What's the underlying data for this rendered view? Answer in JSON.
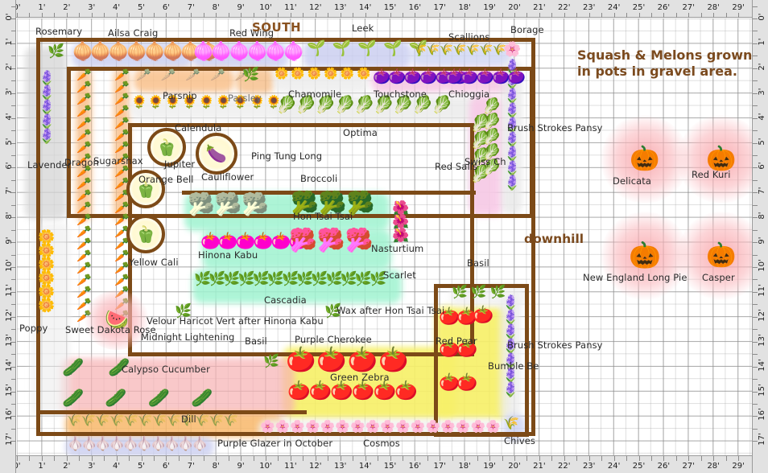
{
  "app": {
    "type": "garden-planner",
    "unit": "feet",
    "grid_cols": 30,
    "grid_rows": 18
  },
  "rulers": {
    "horizontal_ticks": [
      "0'",
      "1'",
      "2'",
      "3'",
      "4'",
      "5'",
      "6'",
      "7'",
      "8'",
      "9'",
      "10'",
      "11'",
      "12'",
      "13'",
      "14'",
      "15'",
      "16'",
      "17'",
      "18'",
      "19'",
      "20'",
      "21'",
      "22'",
      "23'",
      "24'",
      "25'",
      "26'",
      "27'",
      "28'",
      "29'"
    ],
    "vertical_ticks": [
      "0'",
      "1'",
      "2'",
      "3'",
      "4'",
      "5'",
      "6'",
      "7'",
      "8'",
      "9'",
      "10'",
      "11'",
      "12'",
      "13'",
      "14'",
      "15'",
      "16'",
      "17'"
    ]
  },
  "annotations": {
    "compass_south": "SOUTH",
    "gravel_note_line1": "Squash & Melons grown",
    "gravel_note_line2": "in pots in gravel area.",
    "downhill": "downhill"
  },
  "colors": {
    "bed_border": "#7c4a17",
    "note_text": "#7b4a1e",
    "compass_text": "#8a5220",
    "label_text": "#2b2b2b",
    "ruler_bg": "#e2e2e2",
    "grid_line": "#969696",
    "halo_pink": "#f8a0a5",
    "tomato_bed": "#f7f06a",
    "brassica_bed": "#9ff3d0",
    "chard_bed": "#f9c6e6",
    "carrot_bed": "#f9c08a",
    "onion_bed": "#c9cdf0",
    "lavender_bed": "#d9d9d9"
  },
  "labels": [
    {
      "id": "rosemary",
      "text": "Rosemary"
    },
    {
      "id": "ailsa-craig",
      "text": "Ailsa Craig"
    },
    {
      "id": "red-wing",
      "text": "Red Wing"
    },
    {
      "id": "leek",
      "text": "Leek"
    },
    {
      "id": "scallions",
      "text": "Scallions"
    },
    {
      "id": "borage",
      "text": "Borage"
    },
    {
      "id": "parsnip",
      "text": "Parsnip"
    },
    {
      "id": "parsley",
      "text": "Parsley"
    },
    {
      "id": "chamomile",
      "text": "Chamomile"
    },
    {
      "id": "touchstone",
      "text": "Touchstone"
    },
    {
      "id": "chioggia",
      "text": "Chioggia"
    },
    {
      "id": "lavender",
      "text": "Lavender"
    },
    {
      "id": "dragon",
      "text": "Dragon"
    },
    {
      "id": "sugarsnax",
      "text": "Sugarsnax"
    },
    {
      "id": "calendula",
      "text": "Calendula"
    },
    {
      "id": "optima",
      "text": "Optima"
    },
    {
      "id": "jupiter",
      "text": "Jupiter"
    },
    {
      "id": "ping-tung-long",
      "text": "Ping Tung Long"
    },
    {
      "id": "brush-strokes-pansy-top",
      "text": "Brush Strokes Pansy"
    },
    {
      "id": "orange-bell",
      "text": "Orange Bell"
    },
    {
      "id": "cauliflower",
      "text": "Cauliflower"
    },
    {
      "id": "broccoli",
      "text": "Broccoli"
    },
    {
      "id": "swiss-chard",
      "text": "Swiss Ch"
    },
    {
      "id": "red-sails",
      "text": "Red Sails"
    },
    {
      "id": "hon-tsai-tsai",
      "text": "Hon Tsai Tsai"
    },
    {
      "id": "yellow-cali",
      "text": "Yellow Cali"
    },
    {
      "id": "hinona-kabu",
      "text": "Hinona Kabu"
    },
    {
      "id": "nasturtium",
      "text": "Nasturtium"
    },
    {
      "id": "scarlet",
      "text": "Scarlet"
    },
    {
      "id": "basil-top-right",
      "text": "Basil"
    },
    {
      "id": "cascadia",
      "text": "Cascadia"
    },
    {
      "id": "wax-after-hon-tsai-tsai",
      "text": "Wax after Hon Tsai Tsai"
    },
    {
      "id": "velour-haricot-vert",
      "text": "Velour Haricot Vert after Hinona Kabu"
    },
    {
      "id": "poppy",
      "text": "Poppy"
    },
    {
      "id": "sweet-dakota-rose",
      "text": "Sweet Dakota Rose"
    },
    {
      "id": "midnight-lightening",
      "text": "Midnight Lightening"
    },
    {
      "id": "basil-mid",
      "text": "Basil"
    },
    {
      "id": "purple-cherokee",
      "text": "Purple Cherokee"
    },
    {
      "id": "red-pear",
      "text": "Red Pear"
    },
    {
      "id": "brush-strokes-pansy-bottom",
      "text": "Brush Strokes Pansy"
    },
    {
      "id": "bumble-bee",
      "text": "Bumble Be"
    },
    {
      "id": "green-zebra",
      "text": "Green Zebra"
    },
    {
      "id": "calypso-cucumber",
      "text": "Calypso Cucumber"
    },
    {
      "id": "dill",
      "text": "Dill"
    },
    {
      "id": "purple-glazer",
      "text": "Purple Glazer in October"
    },
    {
      "id": "cosmos",
      "text": "Cosmos"
    },
    {
      "id": "chives",
      "text": "Chives"
    },
    {
      "id": "delicata",
      "text": "Delicata"
    },
    {
      "id": "red-kuri",
      "text": "Red Kuri"
    },
    {
      "id": "new-england-long-pie",
      "text": "New England Long Pie"
    },
    {
      "id": "casper",
      "text": "Casper"
    }
  ],
  "plant_labels": {
    "rosemary": "Rosemary",
    "ailsa_craig": "Ailsa Craig",
    "red_wing": "Red Wing",
    "leek": "Leek",
    "scallions": "Scallions",
    "borage": "Borage",
    "parsnip": "Parsnip",
    "parsley": "Parsley",
    "chamomile": "Chamomile",
    "touchstone": "Touchstone",
    "chioggia": "Chioggia",
    "lavender": "Lavender",
    "dragon": "Dragon",
    "sugarsnax": "Sugarsnax",
    "calendula": "Calendula",
    "optima": "Optima",
    "jupiter": "Jupiter",
    "ping_tung_long": "Ping Tung Long",
    "brush_strokes_pansy_top": "Brush Strokes Pansy",
    "orange_bell": "Orange Bell",
    "cauliflower": "Cauliflower",
    "broccoli": "Broccoli",
    "swiss_chard": "Swiss Ch",
    "red_sails": "Red Sails",
    "hon_tsai_tsai": "Hon Tsai Tsai",
    "yellow_cali": "Yellow Cali",
    "hinona_kabu": "Hinona Kabu",
    "nasturtium": "Nasturtium",
    "scarlet": "Scarlet",
    "basil_top_right": "Basil",
    "cascadia": "Cascadia",
    "wax_after": "Wax after Hon Tsai Tsai",
    "velour": "Velour Haricot Vert after Hinona Kabu",
    "poppy": "Poppy",
    "sweet_dakota_rose": "Sweet Dakota Rose",
    "midnight_lightening": "Midnight Lightening",
    "basil_mid": "Basil",
    "purple_cherokee": "Purple Cherokee",
    "red_pear": "Red Pear",
    "brush_strokes_pansy_bottom": "Brush Strokes Pansy",
    "bumble_bee": "Bumble Be",
    "green_zebra": "Green Zebra",
    "calypso_cucumber": "Calypso Cucumber",
    "dill": "Dill",
    "purple_glazer": "Purple Glazer in October",
    "cosmos": "Cosmos",
    "chives": "Chives",
    "delicata": "Delicata",
    "red_kuri": "Red Kuri",
    "new_england_long_pie": "New England Long Pie",
    "casper": "Casper"
  }
}
